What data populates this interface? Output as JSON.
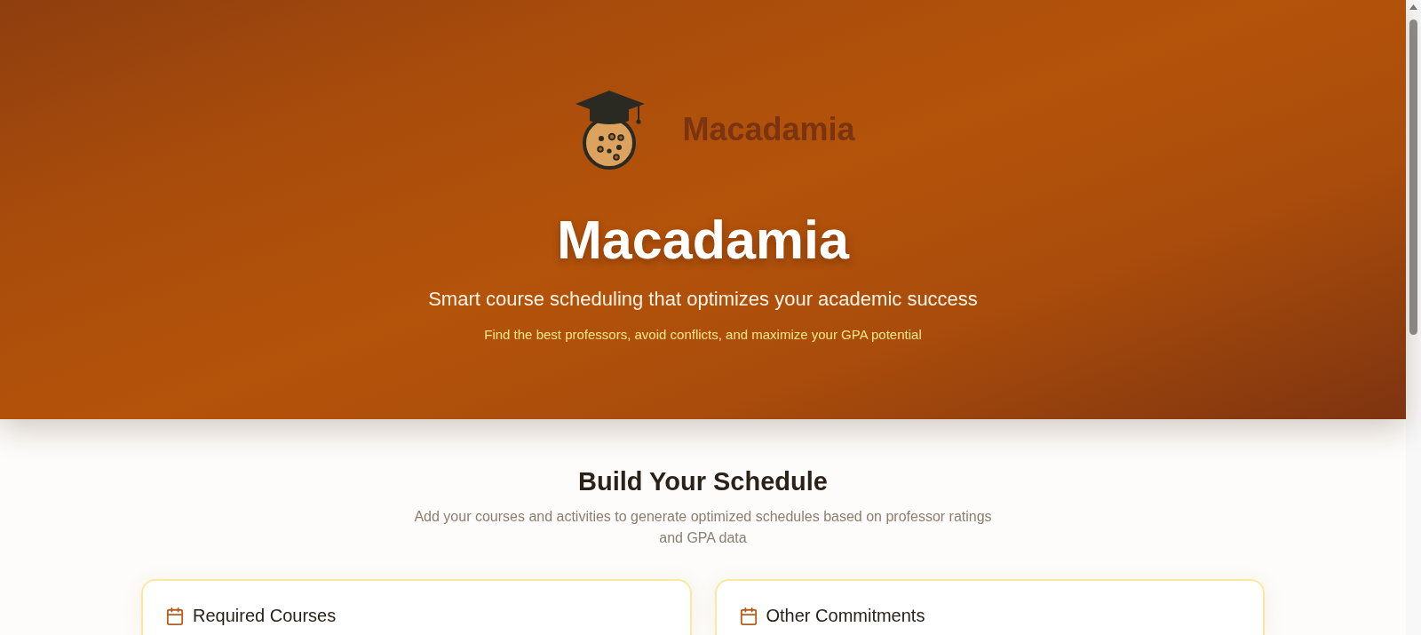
{
  "hero": {
    "logo_text": "Macadamia",
    "title": "Macadamia",
    "subtitle": "Smart course scheduling that optimizes your academic success",
    "tagline": "Find the best professors, avoid conflicts, and maximize your GPA potential"
  },
  "builder": {
    "heading": "Build Your Schedule",
    "description": "Add your courses and activities to generate optimized schedules based on professor ratings and GPA data"
  },
  "cards": [
    {
      "title": "Required Courses"
    },
    {
      "title": "Other Commitments"
    }
  ]
}
